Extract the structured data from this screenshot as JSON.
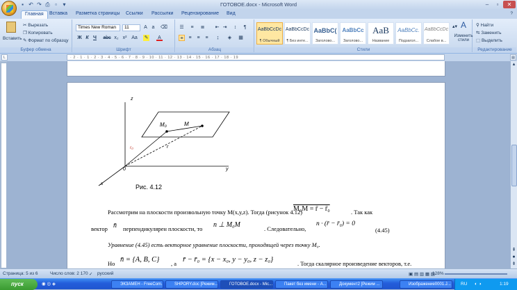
{
  "window": {
    "title": "ГОТОВОЕ.docx - Microsoft Word"
  },
  "tabs": [
    "Главная",
    "Вставка",
    "Разметка страницы",
    "Ссылки",
    "Рассылки",
    "Рецензирование",
    "Вид"
  ],
  "clipboard": {
    "paste": "Вставить",
    "cut": "Вырезать",
    "copy": "Копировать",
    "format": "Формат по образцу",
    "label": "Буфер обмена"
  },
  "font": {
    "name": "Times New Roman",
    "size": "11",
    "label": "Шрифт"
  },
  "paragraph": {
    "label": "Абзац"
  },
  "styles": {
    "label": "Стили",
    "change": "Изменить стили",
    "items": [
      {
        "sample": "AaBbCcDc",
        "name": "¶ Обычный"
      },
      {
        "sample": "AaBbCcDc",
        "name": "¶ Без инте..."
      },
      {
        "sample": "AaBbC(",
        "name": "Заголово..."
      },
      {
        "sample": "AaBbCc",
        "name": "Заголово..."
      },
      {
        "sample": "AaB",
        "name": "Название"
      },
      {
        "sample": "AaBbCc.",
        "name": "Подзагол..."
      },
      {
        "sample": "AaBbCcDc",
        "name": "Слабое в..."
      }
    ]
  },
  "editing": {
    "find": "Найти",
    "replace": "Заменить",
    "select": "Выделить",
    "label": "Редактирование"
  },
  "ruler": "· 2 · 1 · 1 · 2 · 3 · 4 · 5 · 6 · 7 · 8 · 9 · 10 · 11 · 12 · 13 · 14 · 15 · 16 · 17 · 18 · 19",
  "figure": {
    "axis_z": "z",
    "axis_y": "y",
    "axis_x": "x",
    "origin": "0",
    "m0": "M₀",
    "m": "M",
    "r0": "r₀",
    "r": "r",
    "caption": "Рис. 4.12"
  },
  "document": {
    "line1": "Рассмотрим на плоскости произвольную точку M(x,y,z). Тогда (рисунок 4.12)",
    "line1_formula": "M₀M = r̄ − r̄₀",
    "line1_tail": ". Так как",
    "line2_a": "вектор",
    "line2_n": "n̄",
    "line2_b": "перпендикулярен плоскости, то",
    "line2_formula": "n ⊥ M₀M",
    "line2_c": ". Следовательно,",
    "line2_eq": "n · (r̄ − r̄₀) = 0",
    "line2_num": "(4.45)",
    "line3": "Уравнение (4.45) есть векторное уравнение плоскости, проходящей через точку M₀.",
    "line4_a": "Но",
    "line4_f1": "n̄ = {A, B, C}",
    "line4_b": ", а",
    "line4_f2": "r̄ − r̄₀ = {x − x₀, y − y₀, z − z₀}",
    "line4_c": ". Тогда скалярное произведение векторов, т.е."
  },
  "status": {
    "page": "Страница: 5 из 6",
    "words": "Число слов: 2 170",
    "lang": "русский",
    "zoom": "128%"
  },
  "taskbar": {
    "start": "пуск",
    "items": [
      "ЭКЗАМЕН - FreeCom...",
      "SHPORY.doc [Режим...",
      "ГОТОВОЕ.docx - Mic...",
      "Пакет без имени - A...",
      "Документ2 [Режим ...",
      "Изображение0001.J..."
    ],
    "lang": "RU",
    "time": "1:19"
  }
}
